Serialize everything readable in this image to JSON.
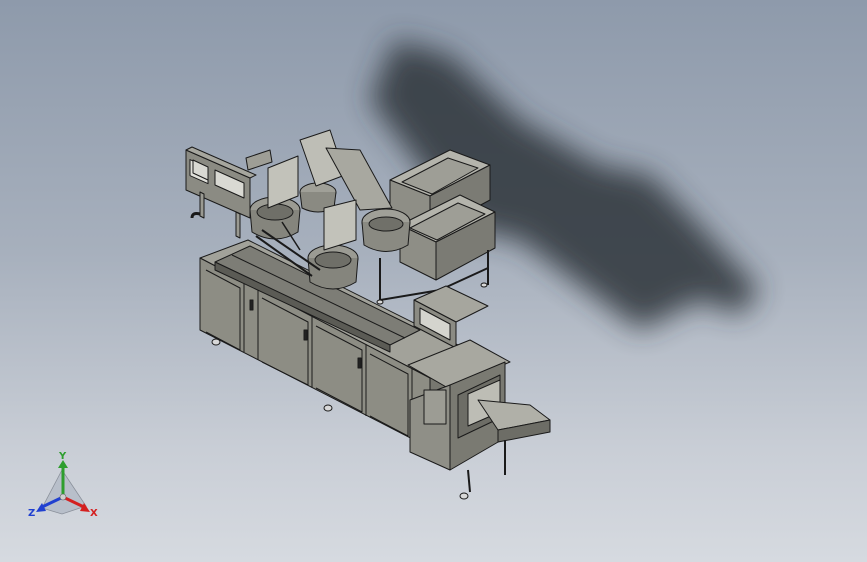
{
  "viewport": {
    "background_top": "#8e9aab",
    "background_bottom": "#d6dae0"
  },
  "triad": {
    "y_label": "Y",
    "x_label": "X",
    "z_label": "Z",
    "y_color": "#2e9e2e",
    "x_color": "#d42020",
    "z_color": "#2040d0"
  },
  "model": {
    "body_color": "#8d8d84",
    "edge_color": "#1a1a1a",
    "shadow_color": "#2f343b",
    "hopper_color": "#979791"
  }
}
